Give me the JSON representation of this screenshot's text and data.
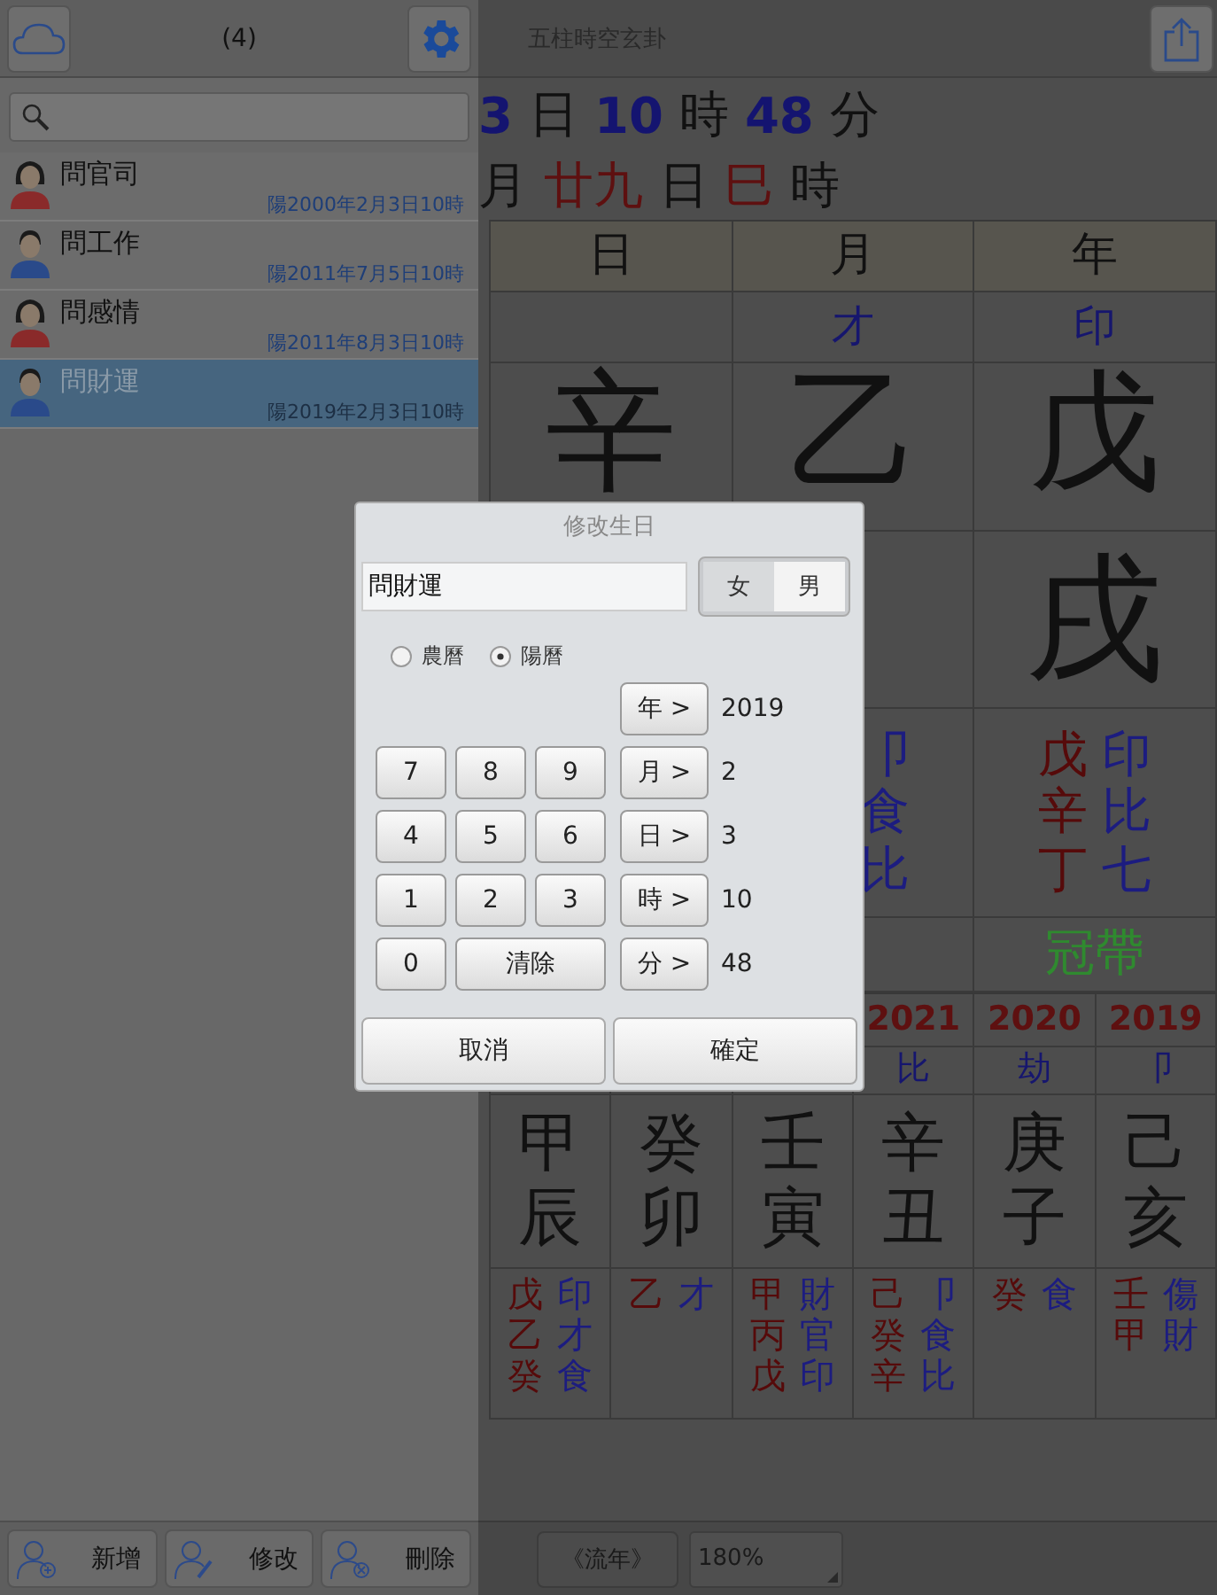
{
  "sidebar": {
    "count": "(4)",
    "items": [
      {
        "kind": "female",
        "name": "問官司",
        "date": "陽2000年2月3日10時",
        "selected": false
      },
      {
        "kind": "male",
        "name": "問工作",
        "date": "陽2011年7月5日10時",
        "selected": false
      },
      {
        "kind": "female",
        "name": "問感情",
        "date": "陽2011年8月3日10時",
        "selected": false
      },
      {
        "kind": "male",
        "name": "問財運",
        "date": "陽2019年2月3日10時",
        "selected": true
      }
    ],
    "toolbar": [
      {
        "kind": "add",
        "label": "新增"
      },
      {
        "kind": "edit",
        "label": "修改"
      },
      {
        "kind": "delete",
        "label": "刪除"
      }
    ]
  },
  "main": {
    "title": "五柱時空玄卦",
    "date_line_1": [
      {
        "kind": "number",
        "text": "3"
      },
      {
        "kind": "unit",
        "text": "日"
      },
      {
        "kind": "number",
        "text": "10"
      },
      {
        "kind": "unit",
        "text": "時"
      },
      {
        "kind": "number",
        "text": "48"
      },
      {
        "kind": "unit",
        "text": "分"
      }
    ],
    "date_line_2": [
      {
        "kind": "unit",
        "text": "月"
      },
      {
        "kind": "ganzhi",
        "text": "廿九"
      },
      {
        "kind": "unit",
        "text": "日"
      },
      {
        "kind": "ganzhi",
        "text": "巳"
      },
      {
        "kind": "unit",
        "text": "時"
      }
    ],
    "pillars": [
      {
        "header": "日",
        "stem": "辛"
      },
      {
        "header": "月",
        "ten_god": "才",
        "stem": "乙",
        "hidden": [
          {
            "god": "卩"
          },
          {
            "god": "食"
          },
          {
            "god": "比"
          }
        ]
      },
      {
        "header": "年",
        "ten_god": "印",
        "stem": "戊",
        "branch": "戌",
        "hidden": [
          {
            "stem": "戊",
            "god": "印"
          },
          {
            "stem": "辛",
            "god": "比"
          },
          {
            "stem": "丁",
            "god": "七"
          }
        ],
        "stage": "冠帶"
      }
    ],
    "years": [
      {
        "stem": "甲",
        "branch": "辰",
        "hidden": [
          {
            "stem": "戊",
            "god": "印"
          },
          {
            "stem": "乙",
            "god": "才"
          },
          {
            "stem": "癸",
            "god": "食"
          }
        ]
      },
      {
        "stem": "癸",
        "branch": "卯",
        "hidden": [
          {
            "stem": "乙",
            "god": "才"
          }
        ]
      },
      {
        "stem": "壬",
        "branch": "寅",
        "hidden": [
          {
            "stem": "甲",
            "god": "財"
          },
          {
            "stem": "丙",
            "god": "官"
          },
          {
            "stem": "戊",
            "god": "印"
          }
        ]
      },
      {
        "year": "2021",
        "god": "比",
        "stem": "辛",
        "branch": "丑",
        "hidden": [
          {
            "stem": "己",
            "god": "卩"
          },
          {
            "stem": "癸",
            "god": "食"
          },
          {
            "stem": "辛",
            "god": "比"
          }
        ]
      },
      {
        "year": "2020",
        "god": "劫",
        "stem": "庚",
        "branch": "子",
        "hidden": [
          {
            "stem": "癸",
            "god": "食"
          }
        ]
      },
      {
        "year": "2019",
        "god": "卩",
        "stem": "己",
        "branch": "亥",
        "hidden": [
          {
            "stem": "壬",
            "god": "傷"
          },
          {
            "stem": "甲",
            "god": "財"
          }
        ]
      }
    ],
    "footer": {
      "button": "《流年》",
      "zoom": "180%"
    }
  },
  "dialog": {
    "title": "修改生日",
    "name": "問財運",
    "gender": [
      {
        "label": "女",
        "selected": false
      },
      {
        "label": "男",
        "selected": true
      }
    ],
    "calendar": [
      {
        "label": "農曆",
        "selected": false
      },
      {
        "label": "陽曆",
        "selected": true
      }
    ],
    "keys": [
      {
        "kind": "digit",
        "label": "7"
      },
      {
        "kind": "digit",
        "label": "8"
      },
      {
        "kind": "digit",
        "label": "9"
      },
      {
        "kind": "digit",
        "label": "4"
      },
      {
        "kind": "digit",
        "label": "5"
      },
      {
        "kind": "digit",
        "label": "6"
      },
      {
        "kind": "digit",
        "label": "1"
      },
      {
        "kind": "digit",
        "label": "2"
      },
      {
        "kind": "digit",
        "label": "3"
      },
      {
        "kind": "digit",
        "label": "0"
      },
      {
        "kind": "clear",
        "label": "清除"
      }
    ],
    "fields": [
      {
        "label": "年 >",
        "value": "2019"
      },
      {
        "label": "月 >",
        "value": "2"
      },
      {
        "label": "日 >",
        "value": "3"
      },
      {
        "label": "時 >",
        "value": "10"
      },
      {
        "label": "分 >",
        "value": "48"
      }
    ],
    "actions": [
      "取消",
      "確定"
    ]
  }
}
